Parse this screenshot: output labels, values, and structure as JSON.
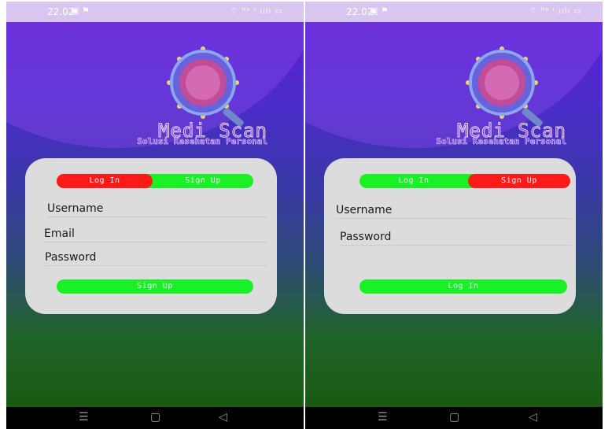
{
  "status": {
    "time": "22.02",
    "icons": "▣ ⚑",
    "right": "⌔ ᴺᵃ ᶦ ıılı ▭"
  },
  "app": {
    "title": "Medi Scan",
    "subtitle": "Solusi Kesehatan Personal"
  },
  "left": {
    "toggle": {
      "login": "Log In",
      "signup": "Sign Up",
      "active": "login"
    },
    "fields": {
      "username": "Username",
      "email": "Email",
      "password": "Password"
    },
    "submit": "Sign Up"
  },
  "right": {
    "toggle": {
      "login": "Log In",
      "signup": "Sign Up",
      "active": "signup"
    },
    "fields": {
      "username": "Username",
      "password": "Password"
    },
    "submit": "Log In"
  },
  "nav": {
    "menu": "☰",
    "home": "▢",
    "back": "◁"
  },
  "colors": {
    "accent_green": "#19f025",
    "accent_red": "#ff1a1a",
    "card": "#dcdcdc"
  },
  "icons": [
    "virus-magnifier-icon",
    "menu-icon",
    "home-icon",
    "back-icon"
  ]
}
